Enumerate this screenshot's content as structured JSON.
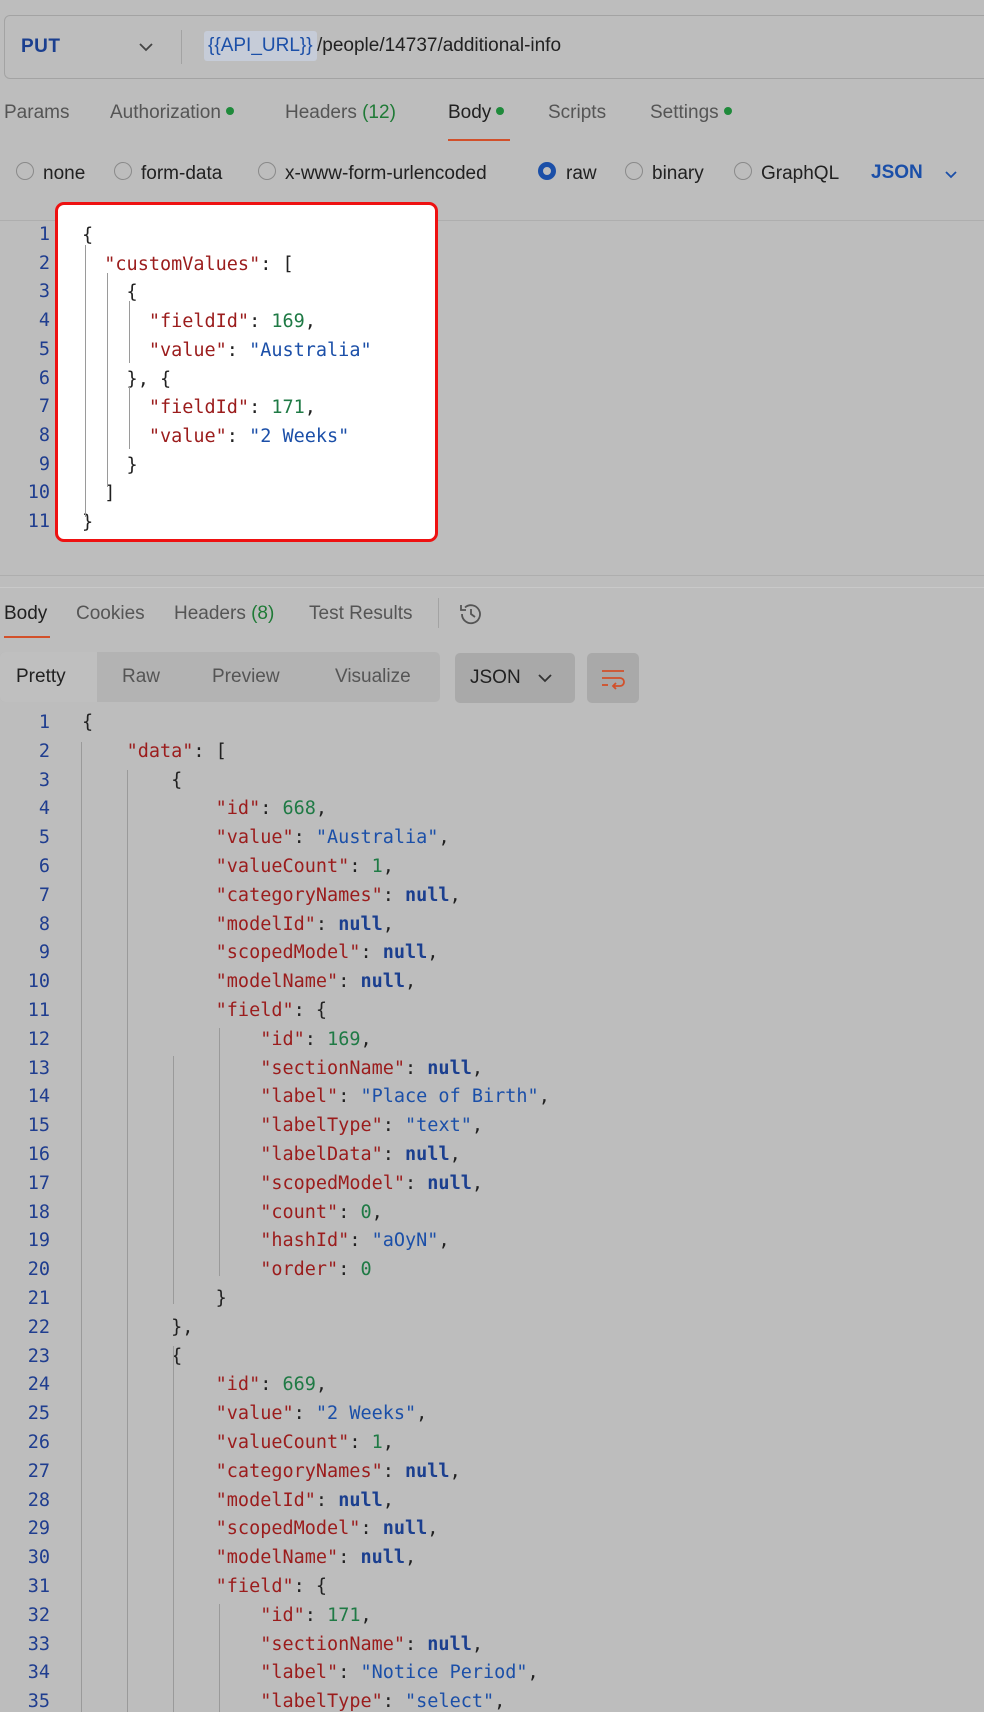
{
  "request": {
    "method": "PUT",
    "url_variable": "{{API_URL}}",
    "url_path": "/people/14737/additional-info",
    "tabs": [
      {
        "label": "Params",
        "count": "",
        "dot": false
      },
      {
        "label": "Authorization",
        "count": "",
        "dot": true
      },
      {
        "label": "Headers",
        "count": "(12)",
        "dot": false
      },
      {
        "label": "Body",
        "count": "",
        "dot": true,
        "active": true
      },
      {
        "label": "Scripts",
        "count": "",
        "dot": false
      },
      {
        "label": "Settings",
        "count": "",
        "dot": true
      }
    ],
    "body_types": [
      {
        "label": "none",
        "checked": false
      },
      {
        "label": "form-data",
        "checked": false
      },
      {
        "label": "x-www-form-urlencoded",
        "checked": false
      },
      {
        "label": "raw",
        "checked": true
      },
      {
        "label": "binary",
        "checked": false
      },
      {
        "label": "GraphQL",
        "checked": false
      }
    ],
    "format": "JSON",
    "body_lines": [
      "{",
      "  \"customValues\": [",
      "    {",
      "      \"fieldId\": 169,",
      "      \"value\": \"Australia\"",
      "    }, {",
      "      \"fieldId\": 171,",
      "      \"value\": \"2 Weeks\"",
      "    }",
      "  ]",
      "}"
    ]
  },
  "response": {
    "tabs": [
      {
        "label": "Body",
        "count": "",
        "active": true
      },
      {
        "label": "Cookies",
        "count": ""
      },
      {
        "label": "Headers",
        "count": "(8)"
      },
      {
        "label": "Test Results",
        "count": ""
      }
    ],
    "view_modes": [
      "Pretty",
      "Raw",
      "Preview",
      "Visualize"
    ],
    "format": "JSON",
    "body_lines": [
      "{",
      "    \"data\": [",
      "        {",
      "            \"id\": 668,",
      "            \"value\": \"Australia\",",
      "            \"valueCount\": 1,",
      "            \"categoryNames\": null,",
      "            \"modelId\": null,",
      "            \"scopedModel\": null,",
      "            \"modelName\": null,",
      "            \"field\": {",
      "                \"id\": 169,",
      "                \"sectionName\": null,",
      "                \"label\": \"Place of Birth\",",
      "                \"labelType\": \"text\",",
      "                \"labelData\": null,",
      "                \"scopedModel\": null,",
      "                \"count\": 0,",
      "                \"hashId\": \"aOyN\",",
      "                \"order\": 0",
      "            }",
      "        },",
      "        {",
      "            \"id\": 669,",
      "            \"value\": \"2 Weeks\",",
      "            \"valueCount\": 1,",
      "            \"categoryNames\": null,",
      "            \"modelId\": null,",
      "            \"scopedModel\": null,",
      "            \"modelName\": null,",
      "            \"field\": {",
      "                \"id\": 171,",
      "                \"sectionName\": null,",
      "                \"label\": \"Notice Period\",",
      "                \"labelType\": \"select\","
    ]
  }
}
